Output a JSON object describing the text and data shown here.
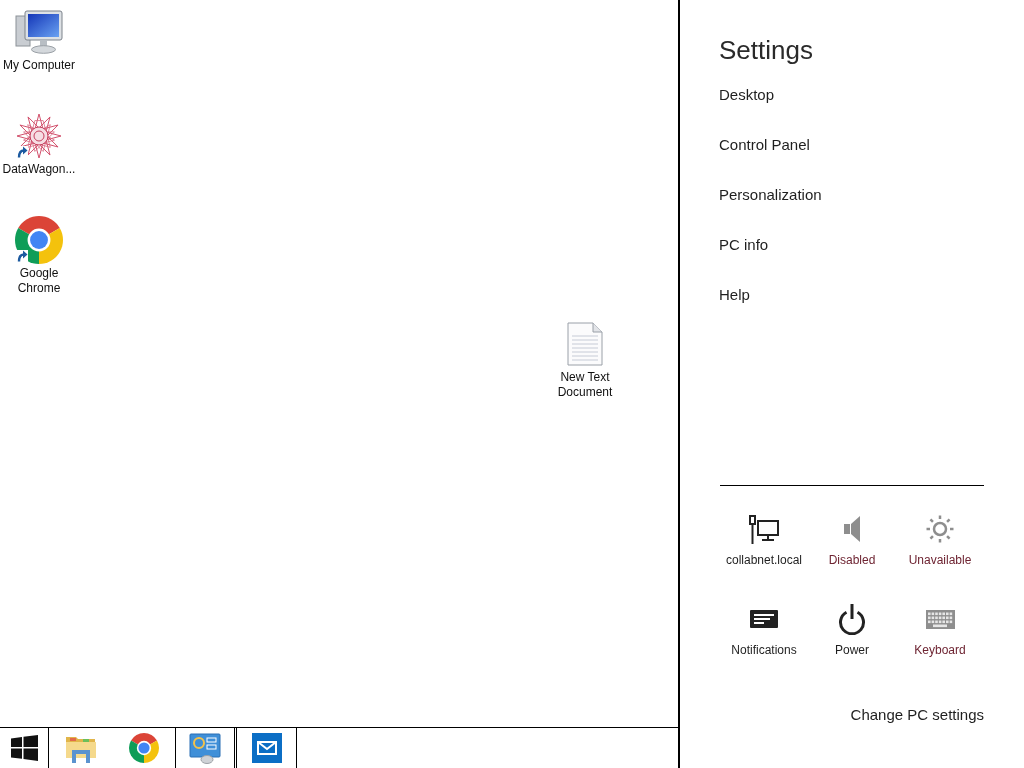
{
  "desktop": {
    "icons": [
      {
        "kind": "computer",
        "label": "My Computer",
        "shortcut": false
      },
      {
        "kind": "app",
        "label": "DataWagon...",
        "shortcut": true
      },
      {
        "kind": "browser",
        "label": "Google Chrome",
        "shortcut": true
      },
      {
        "kind": "text_file",
        "label": "New Text Document",
        "shortcut": false
      }
    ]
  },
  "settings": {
    "title": "Settings",
    "links": [
      "Desktop",
      "Control Panel",
      "Personalization",
      "PC info",
      "Help"
    ],
    "quick_settings": [
      {
        "kind": "network",
        "label": "collabnet.local",
        "disabled": false
      },
      {
        "kind": "volume",
        "label": "Disabled",
        "disabled": true
      },
      {
        "kind": "brightness",
        "label": "Unavailable",
        "disabled": true
      },
      {
        "kind": "notifications",
        "label": "Notifications",
        "disabled": false
      },
      {
        "kind": "power",
        "label": "Power",
        "disabled": false
      },
      {
        "kind": "keyboard",
        "label": "Keyboard",
        "disabled": true
      }
    ],
    "footer_link": "Change PC settings"
  }
}
